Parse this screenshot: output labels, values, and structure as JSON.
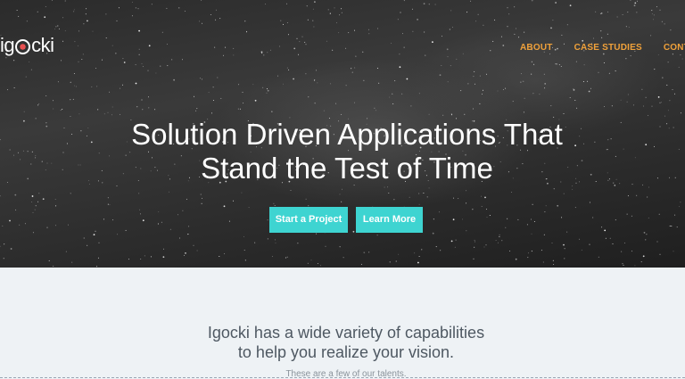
{
  "brand": {
    "logo_prefix": "ig",
    "logo_suffix": "cki"
  },
  "nav": {
    "items": [
      "ABOUT",
      "CASE STUDIES",
      "CONTACT"
    ]
  },
  "hero": {
    "headline_line1": "Solution Driven Applications That",
    "headline_line2": "Stand the Test of Time",
    "start_project_label": "Start a Project",
    "learn_more_label": "Learn More"
  },
  "capabilities": {
    "tagline_line1": "Igocki has a wide variety of capabilities",
    "tagline_line2": "to help you realize your vision.",
    "subline": "These are a few of our talents."
  },
  "colors": {
    "accent": "#3ed4d1",
    "nav_link": "#f0a13a",
    "section_bg": "#eef2f5"
  }
}
